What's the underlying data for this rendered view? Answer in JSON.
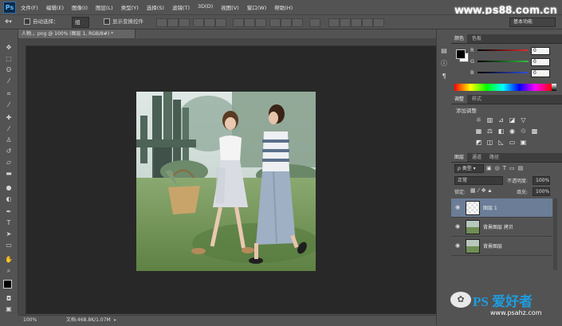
{
  "app": {
    "logo": "Ps"
  },
  "menu": [
    "文件(F)",
    "编辑(E)",
    "图像(I)",
    "图层(L)",
    "类型(Y)",
    "选择(S)",
    "滤镜(T)",
    "3D(D)",
    "视图(V)",
    "窗口(W)",
    "帮助(H)"
  ],
  "watermark_top": "www.ps88.com.cn",
  "options": {
    "auto_select_label": "自动选择：",
    "auto_select_value": "组",
    "show_transform_label": "显示变换控件",
    "workspace": "基本功能"
  },
  "document": {
    "tab_title": "人物.，png @ 100% (图层 1, RGB/8#) *",
    "zoom": "100%",
    "doc_info": "文档:468.8K/1.07M"
  },
  "color_panel": {
    "tabs": [
      "颜色",
      "色板"
    ],
    "channels": [
      {
        "label": "R",
        "value": "0",
        "color": "#e03030"
      },
      {
        "label": "G",
        "value": "0",
        "color": "#30c040"
      },
      {
        "label": "B",
        "value": "0",
        "color": "#3050e0"
      }
    ]
  },
  "adjust_panel": {
    "tabs": [
      "调整",
      "样式"
    ],
    "title": "添加调整"
  },
  "layers_panel": {
    "tabs": [
      "图层",
      "通道",
      "路径"
    ],
    "kind_filter": "类型",
    "blend_mode": "正常",
    "opacity_label": "不透明度:",
    "opacity_value": "100%",
    "lock_label": "锁定:",
    "fill_label": "填充:",
    "fill_value": "100%",
    "layers": [
      {
        "name": "图层 1",
        "selected": true
      },
      {
        "name": "背景图层 拷贝",
        "selected": false
      },
      {
        "name": "背景图层",
        "selected": false
      }
    ]
  },
  "watermark_bottom": {
    "brand": "PS 爱好者",
    "url": "www.psahz.com"
  }
}
